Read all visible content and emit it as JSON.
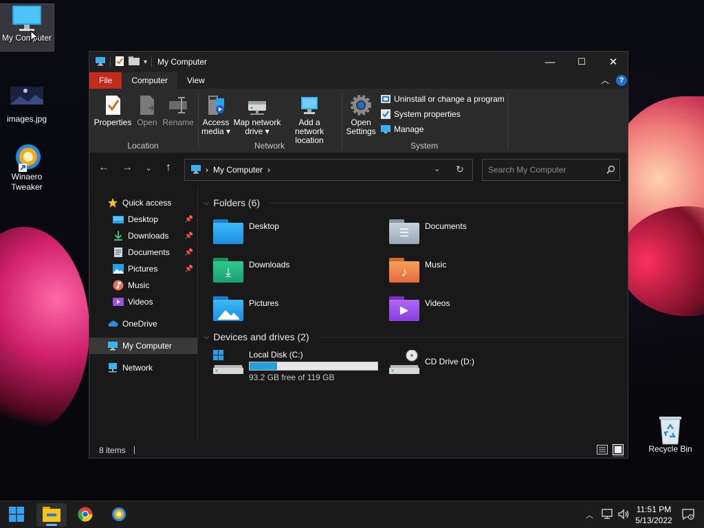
{
  "desktop": {
    "icons": [
      {
        "label": "My Computer",
        "icon": "monitor-icon"
      },
      {
        "label": "images.jpg",
        "icon": "image-thumbnail-icon"
      },
      {
        "label": "Winaero Tweaker",
        "icon": "winaero-tweaker-icon"
      },
      {
        "label": "Recycle Bin",
        "icon": "recycle-bin-icon"
      }
    ]
  },
  "window": {
    "title": "My Computer",
    "controls": {
      "minimize": "—",
      "maximize": "☐",
      "close": "✕"
    },
    "tabs": [
      "File",
      "Computer",
      "View"
    ],
    "active_tab": "Computer",
    "ribbon": {
      "location": {
        "group": "Location",
        "buttons": [
          "Properties",
          "Open",
          "Rename"
        ]
      },
      "network": {
        "group": "Network",
        "access_media": "Access media ▾",
        "map_drive": "Map network drive ▾",
        "add_location": "Add a network location"
      },
      "system": {
        "group": "System",
        "open_settings": "Open Settings",
        "items": [
          "Uninstall or change a program",
          "System properties",
          "Manage"
        ]
      }
    },
    "address": {
      "path": "My Computer",
      "separator": "›",
      "search_placeholder": "Search My Computer"
    },
    "nav": {
      "quick_access": "Quick access",
      "items": [
        "Desktop",
        "Downloads",
        "Documents",
        "Pictures",
        "Music",
        "Videos"
      ],
      "onedrive": "OneDrive",
      "my_computer": "My Computer",
      "network": "Network"
    },
    "folders": {
      "header": "Folders (6)",
      "items": [
        "Desktop",
        "Documents",
        "Downloads",
        "Music",
        "Pictures",
        "Videos"
      ]
    },
    "drives": {
      "header": "Devices and drives (2)",
      "local": {
        "name": "Local Disk (C:)",
        "free_text": "93.2 GB free of 119 GB",
        "used_fraction": 0.217
      },
      "cd": {
        "name": "CD Drive (D:)"
      }
    },
    "status": {
      "items": "8 items"
    }
  },
  "taskbar": {
    "time": "11:51 PM",
    "date": "5/13/2022"
  },
  "colors": {
    "accent": "#0078d4",
    "file_tab": "#c42b1c",
    "drive_bar": "#26a0da"
  }
}
